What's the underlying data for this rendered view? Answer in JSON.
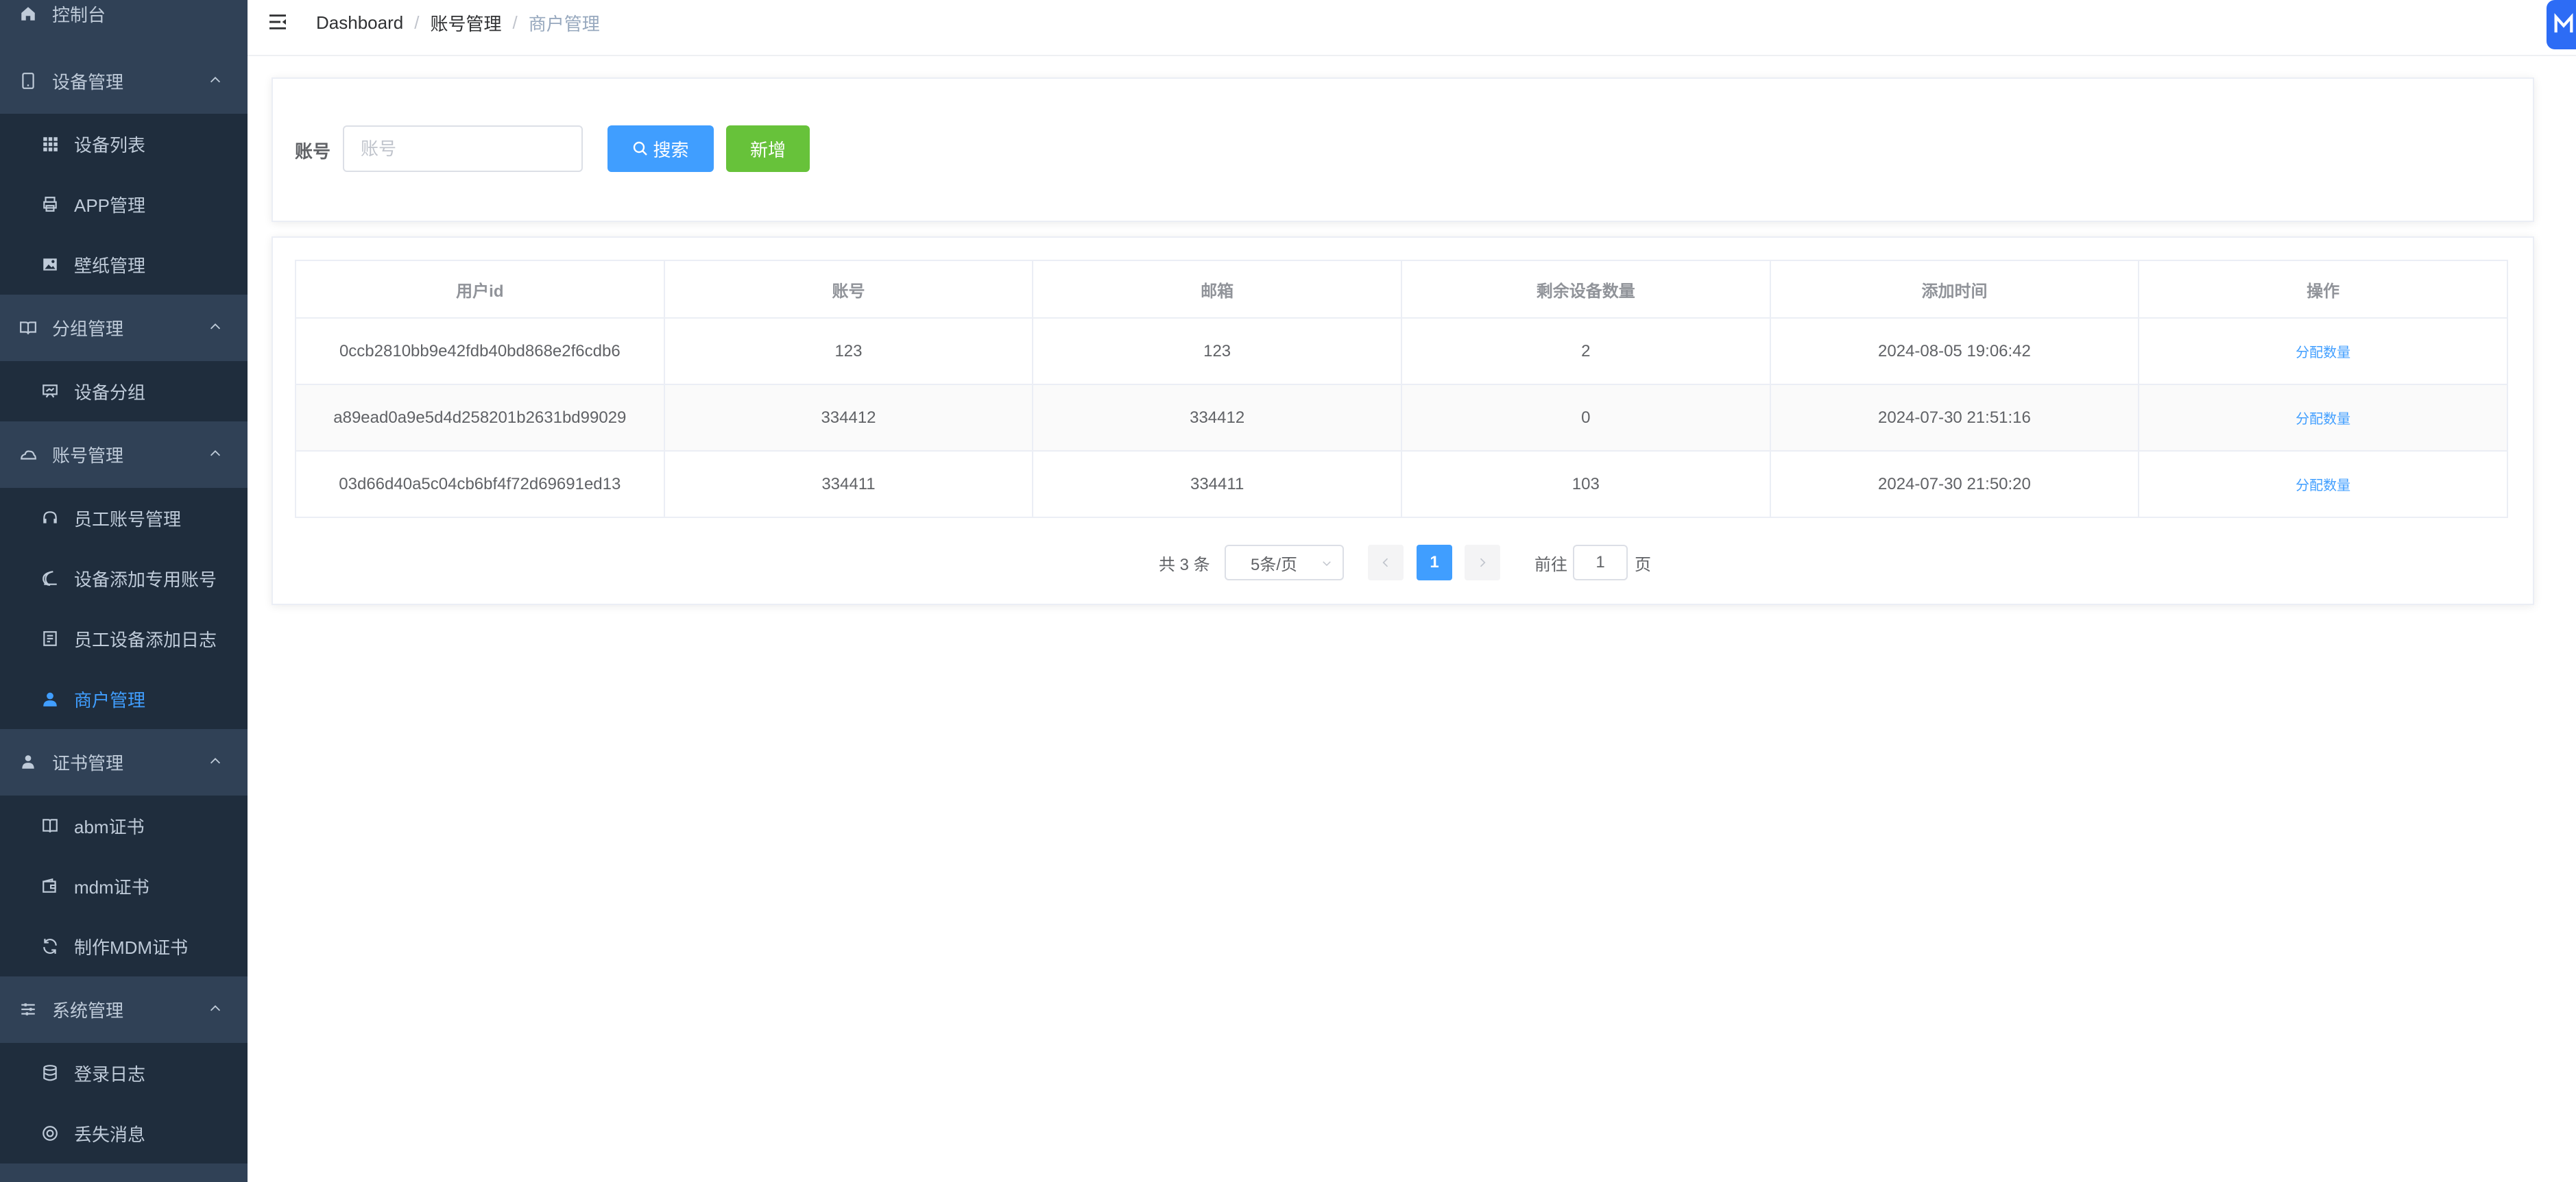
{
  "sidebar": {
    "items": [
      {
        "label": "控制台",
        "type": "top"
      },
      {
        "label": "设备管理",
        "type": "group"
      },
      {
        "label": "设备列表",
        "type": "child"
      },
      {
        "label": "APP管理",
        "type": "child"
      },
      {
        "label": "壁纸管理",
        "type": "child"
      },
      {
        "label": "分组管理",
        "type": "group"
      },
      {
        "label": "设备分组",
        "type": "child"
      },
      {
        "label": "账号管理",
        "type": "group"
      },
      {
        "label": "员工账号管理",
        "type": "child"
      },
      {
        "label": "设备添加专用账号",
        "type": "child"
      },
      {
        "label": "员工设备添加日志",
        "type": "child"
      },
      {
        "label": "商户管理",
        "type": "child",
        "active": true
      },
      {
        "label": "证书管理",
        "type": "group"
      },
      {
        "label": "abm证书",
        "type": "child"
      },
      {
        "label": "mdm证书",
        "type": "child"
      },
      {
        "label": "制作MDM证书",
        "type": "child"
      },
      {
        "label": "系统管理",
        "type": "group"
      },
      {
        "label": "登录日志",
        "type": "child"
      },
      {
        "label": "丢失消息",
        "type": "child"
      }
    ]
  },
  "breadcrumb": [
    "Dashboard",
    "账号管理",
    "商户管理"
  ],
  "search": {
    "label": "账号",
    "placeholder": "账号",
    "value": "",
    "search_button": "搜索",
    "add_button": "新增"
  },
  "table": {
    "columns": [
      "用户id",
      "账号",
      "邮箱",
      "剩余设备数量",
      "添加时间",
      "操作"
    ],
    "rows": [
      [
        "0ccb2810bb9e42fdb40bd868e2f6cdb6",
        "123",
        "123",
        "2",
        "2024-08-05 19:06:42",
        "分配数量"
      ],
      [
        "a89ead0a9e5d4d258201b2631bd99029",
        "334412",
        "334412",
        "0",
        "2024-07-30 21:51:16",
        "分配数量"
      ],
      [
        "03d66d40a5c04cb6bf4f72d69691ed13",
        "334411",
        "334411",
        "103",
        "2024-07-30 21:50:20",
        "分配数量"
      ]
    ]
  },
  "pagination": {
    "total": "共 3 条",
    "page_size": "5条/页",
    "current_page": "1",
    "goto_label": "前往",
    "goto_value": "1",
    "goto_unit": "页"
  },
  "colors": {
    "sidebar_bg": "#304156",
    "submenu_bg": "#1f2d3d",
    "primary": "#409eff",
    "success": "#67c23a"
  }
}
